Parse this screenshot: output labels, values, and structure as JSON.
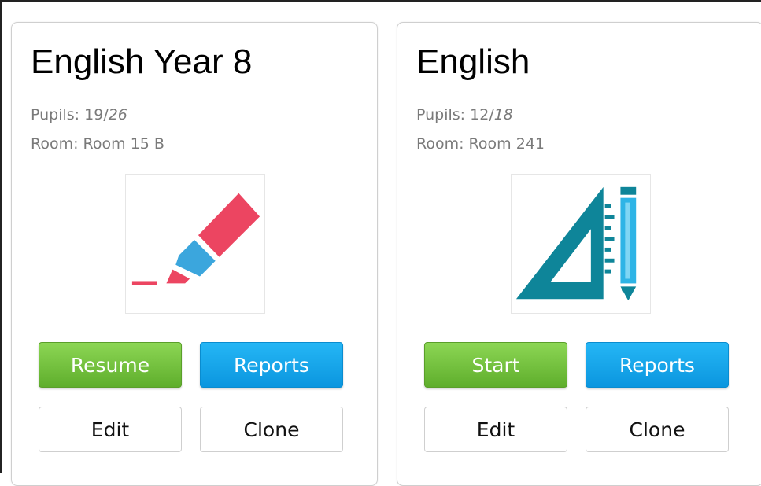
{
  "classes": [
    {
      "title": "English Year 8",
      "pupils_label": "Pupils: ",
      "pupils_present": "19",
      "pupils_sep": "/",
      "pupils_total": "26",
      "room_label": "Room: ",
      "room": "Room 15 B",
      "icon": "highlighter-icon",
      "primary_action": "Resume",
      "reports_label": "Reports",
      "edit_label": "Edit",
      "clone_label": "Clone"
    },
    {
      "title": "English",
      "pupils_label": "Pupils: ",
      "pupils_present": "12",
      "pupils_sep": "/",
      "pupils_total": "18",
      "room_label": "Room: ",
      "room": "Room 241",
      "icon": "set-square-pencil-icon",
      "primary_action": "Start",
      "reports_label": "Reports",
      "edit_label": "Edit",
      "clone_label": "Clone"
    }
  ],
  "colors": {
    "green_button": "#6cbf3a",
    "blue_button": "#19a8ec",
    "highlighter_red": "#ec4561",
    "highlighter_blue": "#3ba6dd",
    "setsquare_teal": "#0e8599",
    "pencil_blue": "#2eb4e6"
  }
}
